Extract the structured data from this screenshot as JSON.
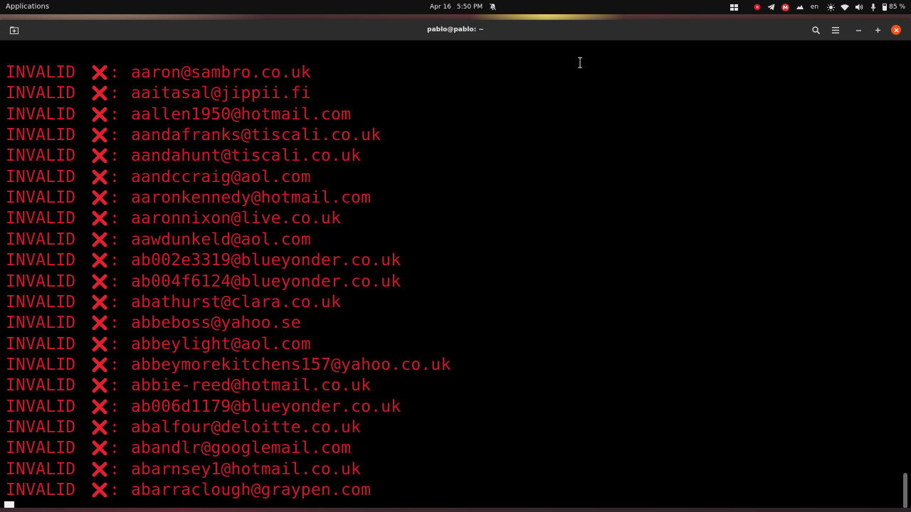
{
  "top_panel": {
    "applications_label": "Applications",
    "date": "Apr 16",
    "time": "5:50 PM",
    "keyboard_layout": "en",
    "battery": "85 %"
  },
  "window": {
    "title": "pablo@pablo: ~"
  },
  "terminal": {
    "colors": {
      "text": "#d4152a",
      "background": "#000000"
    },
    "lines": [
      {
        "status": "INVALID",
        "sep": ":",
        "email": "aaron@sambro.co.uk"
      },
      {
        "status": "INVALID",
        "sep": ":",
        "email": "aaitasal@jippii.fi"
      },
      {
        "status": "INVALID",
        "sep": ":",
        "email": "aallen1950@hotmail.com"
      },
      {
        "status": "INVALID",
        "sep": ":",
        "email": "aandafranks@tiscali.co.uk"
      },
      {
        "status": "INVALID",
        "sep": ":",
        "email": "aandahunt@tiscali.co.uk"
      },
      {
        "status": "INVALID",
        "sep": ":",
        "email": "aandccraig@aol.com"
      },
      {
        "status": "INVALID",
        "sep": ":",
        "email": "aaronkennedy@hotmail.com"
      },
      {
        "status": "INVALID",
        "sep": ":",
        "email": "aaronnixon@live.co.uk"
      },
      {
        "status": "INVALID",
        "sep": ":",
        "email": "aawdunkeld@aol.com"
      },
      {
        "status": "INVALID",
        "sep": ":",
        "email": "ab002e3319@blueyonder.co.uk"
      },
      {
        "status": "INVALID",
        "sep": ":",
        "email": "ab004f6124@blueyonder.co.uk"
      },
      {
        "status": "INVALID",
        "sep": ":",
        "email": "abathurst@clara.co.uk"
      },
      {
        "status": "INVALID",
        "sep": ":",
        "email": "abbeboss@yahoo.se"
      },
      {
        "status": "INVALID",
        "sep": ":",
        "email": "abbeylight@aol.com"
      },
      {
        "status": "INVALID",
        "sep": ":",
        "email": "abbeymorekitchens157@yahoo.co.uk"
      },
      {
        "status": "INVALID",
        "sep": ":",
        "email": "abbie-reed@hotmail.co.uk"
      },
      {
        "status": "INVALID",
        "sep": ":",
        "email": "ab006d1179@blueyonder.co.uk"
      },
      {
        "status": "INVALID",
        "sep": ":",
        "email": "abalfour@deloitte.co.uk"
      },
      {
        "status": "INVALID",
        "sep": ":",
        "email": "abandlr@googlemail.com"
      },
      {
        "status": "INVALID",
        "sep": ":",
        "email": "abarnsey1@hotmail.co.uk"
      },
      {
        "status": "INVALID",
        "sep": ":",
        "email": "abarraclough@graypen.com"
      }
    ]
  }
}
